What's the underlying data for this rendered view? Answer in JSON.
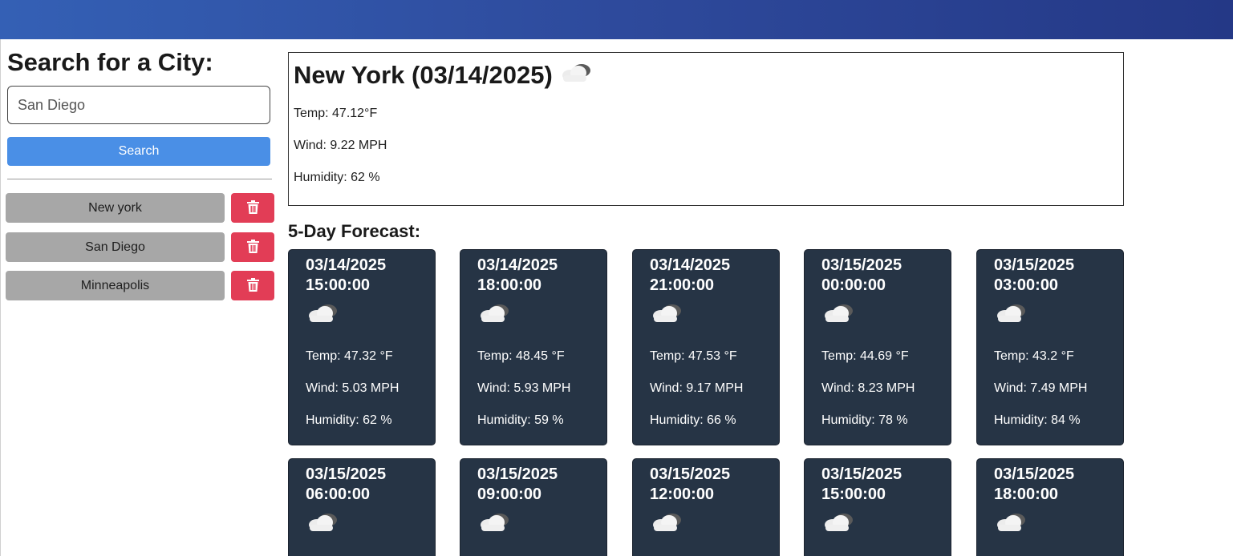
{
  "sidebar": {
    "title": "Search for a City:",
    "search_value": "San Diego",
    "search_button": "Search",
    "history": [
      {
        "label": "New york"
      },
      {
        "label": "San Diego"
      },
      {
        "label": "Minneapolis"
      }
    ],
    "delete_icon": "trash-icon"
  },
  "today": {
    "title": "New York (03/14/2025)",
    "icon": "cloud-icon",
    "temp": "Temp: 47.12°F",
    "wind": "Wind: 9.22 MPH",
    "humidity": "Humidity: 62 %"
  },
  "forecast": {
    "title": "5-Day Forecast:",
    "cards": [
      {
        "date": "03/14/2025",
        "time": "15:00:00",
        "temp": "Temp: 47.32 °F",
        "wind": "Wind: 5.03 MPH",
        "humidity": "Humidity: 62 %"
      },
      {
        "date": "03/14/2025",
        "time": "18:00:00",
        "temp": "Temp: 48.45 °F",
        "wind": "Wind: 5.93 MPH",
        "humidity": "Humidity: 59 %"
      },
      {
        "date": "03/14/2025",
        "time": "21:00:00",
        "temp": "Temp: 47.53 °F",
        "wind": "Wind: 9.17 MPH",
        "humidity": "Humidity: 66 %"
      },
      {
        "date": "03/15/2025",
        "time": "00:00:00",
        "temp": "Temp: 44.69 °F",
        "wind": "Wind: 8.23 MPH",
        "humidity": "Humidity: 78 %"
      },
      {
        "date": "03/15/2025",
        "time": "03:00:00",
        "temp": "Temp: 43.2 °F",
        "wind": "Wind: 7.49 MPH",
        "humidity": "Humidity: 84 %"
      },
      {
        "date": "03/15/2025",
        "time": "06:00:00"
      },
      {
        "date": "03/15/2025",
        "time": "09:00:00"
      },
      {
        "date": "03/15/2025",
        "time": "12:00:00"
      },
      {
        "date": "03/15/2025",
        "time": "15:00:00"
      },
      {
        "date": "03/15/2025",
        "time": "18:00:00"
      }
    ]
  },
  "colors": {
    "header": "#2e4a9c",
    "search_button": "#4a8fe6",
    "history_button": "#a7a7a7",
    "delete_button": "#e23d56",
    "card_bg": "#263445"
  }
}
